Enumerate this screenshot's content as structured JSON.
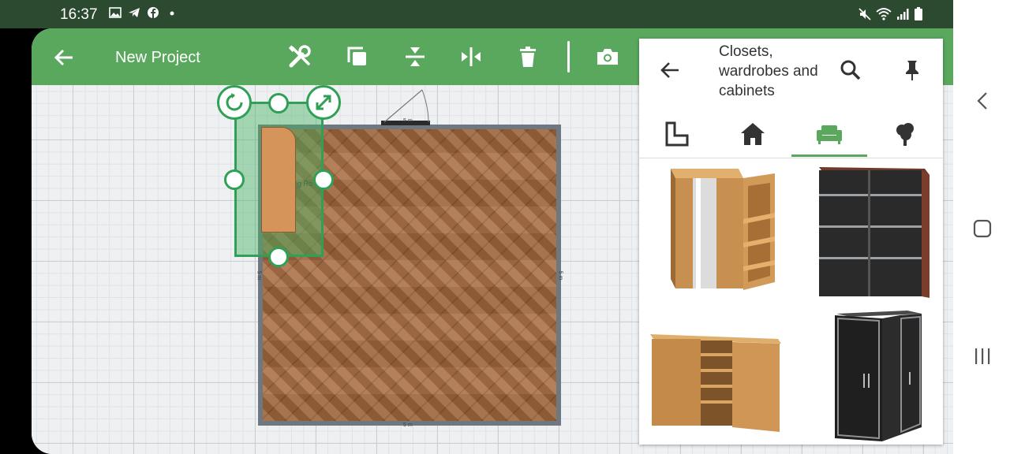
{
  "status_bar": {
    "time": "16:37",
    "left_icons": [
      "image-icon",
      "telegram-icon",
      "facebook-icon",
      "dot-icon"
    ],
    "right_icons": [
      "mute-icon",
      "wifi-icon",
      "signal-icon",
      "battery-icon"
    ]
  },
  "app_bar": {
    "title": "New Project",
    "tools": [
      "tools-icon",
      "duplicate-icon",
      "flip-vertical-icon",
      "flip-horizontal-icon",
      "delete-icon",
      "camera-icon"
    ]
  },
  "canvas": {
    "room_label": "ing Ro 5 m²)",
    "dimensions": {
      "top": "5 m",
      "bottom": "5 m",
      "left": "5 m",
      "right": "5 m"
    }
  },
  "panel": {
    "title": "Closets, wardrobes and cabinets",
    "tabs": [
      "floor-plan-icon",
      "house-icon",
      "furniture-icon",
      "tree-icon"
    ],
    "active_tab": 2,
    "items": [
      "wardrobe-mirror-shelves",
      "wardrobe-dark-sliding",
      "cabinet-wood-shelves",
      "wardrobe-corner-dark"
    ]
  },
  "colors": {
    "app_bar": "#5aa75e",
    "status_bar": "#2c4a30",
    "selection": "#2fa055"
  }
}
